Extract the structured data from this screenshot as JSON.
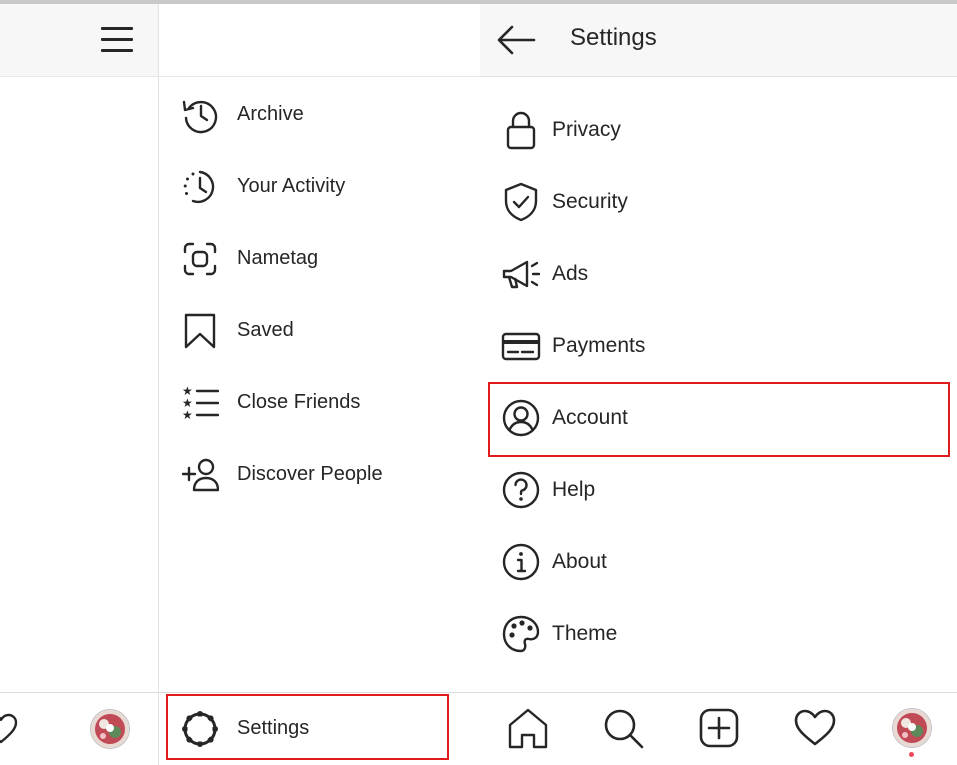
{
  "drawer": {
    "items": [
      {
        "label": "Archive",
        "icon": "archive-icon"
      },
      {
        "label": "Your Activity",
        "icon": "activity-icon"
      },
      {
        "label": "Nametag",
        "icon": "nametag-icon"
      },
      {
        "label": "Saved",
        "icon": "bookmark-icon"
      },
      {
        "label": "Close Friends",
        "icon": "close-friends-icon"
      },
      {
        "label": "Discover People",
        "icon": "add-person-icon"
      }
    ],
    "settings_label": "Settings"
  },
  "settings": {
    "title": "Settings",
    "items": [
      {
        "label": "Privacy",
        "icon": "lock-icon"
      },
      {
        "label": "Security",
        "icon": "shield-check-icon"
      },
      {
        "label": "Ads",
        "icon": "megaphone-icon"
      },
      {
        "label": "Payments",
        "icon": "credit-card-icon"
      },
      {
        "label": "Account",
        "icon": "account-icon"
      },
      {
        "label": "Help",
        "icon": "help-icon"
      },
      {
        "label": "About",
        "icon": "info-icon"
      },
      {
        "label": "Theme",
        "icon": "palette-icon"
      }
    ]
  },
  "bottom_nav": [
    "home-icon",
    "search-icon",
    "new-post-icon",
    "activity-heart-icon",
    "profile-avatar"
  ],
  "colors": {
    "highlight": "#e01b1b",
    "text": "#262626",
    "header_bg": "#f7f7f7",
    "notification_dot": "#ed4956"
  }
}
